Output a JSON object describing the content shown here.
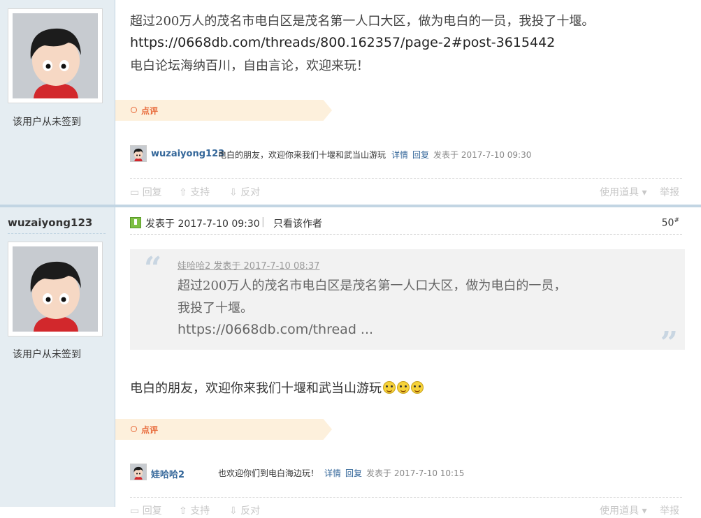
{
  "post1": {
    "sidebar": {
      "sign_note": "该用户从未签到"
    },
    "content": {
      "line1": "超过200万人的茂名市电白区是茂名第一人口大区，做为电白的一员，我投了十堰。",
      "url": "https://0668db.com/threads/800.162357/page-2#post-3615442",
      "line3": "电白论坛海纳百川，自由言论，欢迎来玩！"
    },
    "rate_label": "点评",
    "comment": {
      "user": "wuzaiyong123",
      "text": "电白的朋友，欢迎你来我们十堰和武当山游玩",
      "detail": "详情",
      "reply": "回复",
      "time": "发表于 2017-7-10 09:30"
    },
    "actions": {
      "reply": "回复",
      "support": "支持",
      "oppose": "反对",
      "tools": "使用道具",
      "report": "举报"
    }
  },
  "post2": {
    "sidebar": {
      "username": "wuzaiyong123",
      "sign_note": "该用户从未签到"
    },
    "header": {
      "posted": "发表于 2017-7-10 09:30",
      "sep": "|",
      "only_author": "只看该作者",
      "floor_num": "50",
      "floor_sup": "#"
    },
    "quote": {
      "meta": "娃哈哈2 发表于 2017-7-10 08:37",
      "line1": "超过200万人的茂名市电白区是茂名第一人口大区，做为电白的一员，",
      "line2": "我投了十堰。",
      "line3": "https://0668db.com/thread ...",
      "open_mark": "“",
      "close_mark": "”"
    },
    "content": "电白的朋友，欢迎你来我们十堰和武当山游玩",
    "rate_label": "点评",
    "comment": {
      "user": "娃哈哈2",
      "text": "也欢迎你们到电白海边玩！",
      "detail": "详情",
      "reply": "回复",
      "time": "发表于 2017-7-10 10:15"
    },
    "actions": {
      "reply": "回复",
      "support": "支持",
      "oppose": "反对",
      "tools": "使用道具",
      "report": "举报"
    }
  },
  "colors": {
    "sidebar_bg": "#e5edf2",
    "link": "#336699",
    "rate_accent": "#e86a3a",
    "rate_bg": "#fdf0dc"
  },
  "icons": [
    "avatar-cartoon",
    "post-icon",
    "smiley-icon",
    "reply-icon",
    "support-icon",
    "oppose-icon"
  ]
}
